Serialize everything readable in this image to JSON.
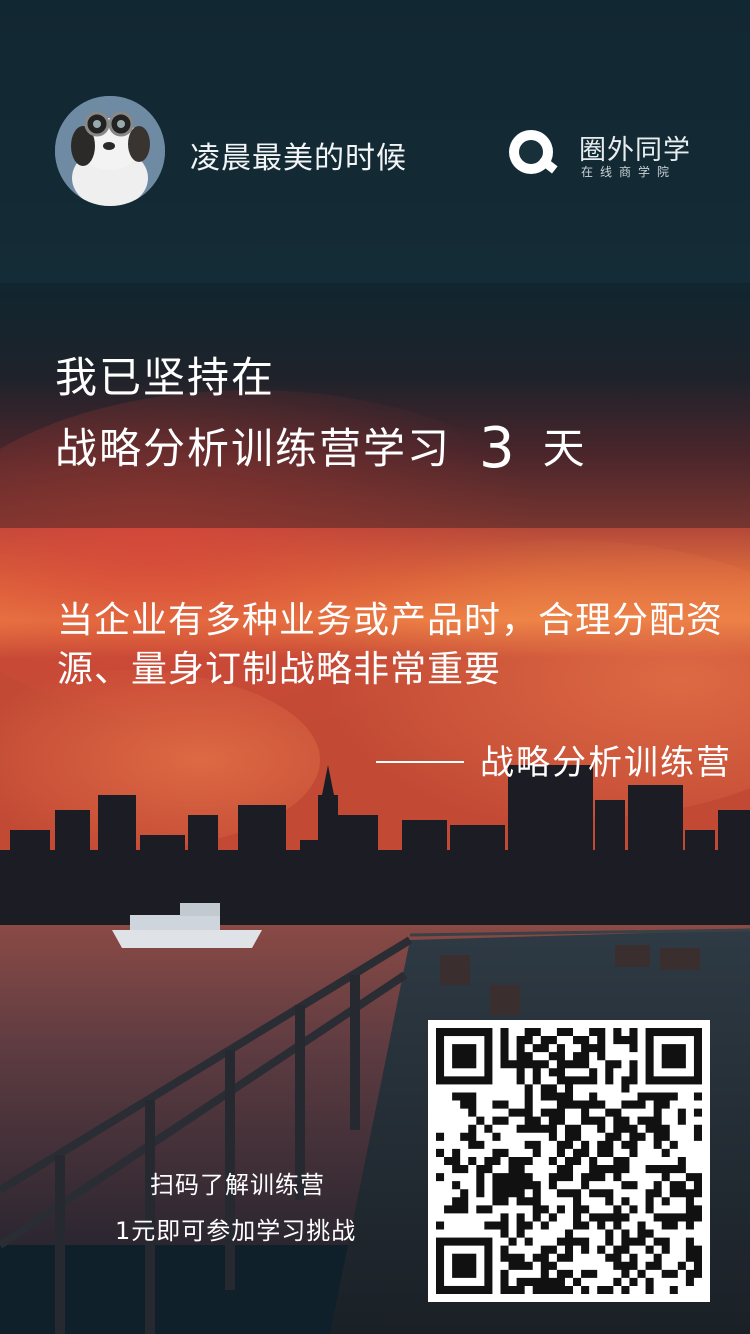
{
  "profile": {
    "username": "凌晨最美的时候",
    "avatar_icon": "dog-with-glasses-avatar"
  },
  "brand": {
    "name": "圈外同学",
    "subtitle": "在线商学院",
    "logo_icon": "q-logo-icon",
    "color": "#ffffff"
  },
  "headline": {
    "line1": "我已坚持在",
    "line2_prefix": "战略分析训练营学习",
    "days": "3",
    "day_unit": "天"
  },
  "quote": {
    "text": "当企业有多种业务或产品时，合理分配资源、量身订制战略非常重要",
    "attribution": "战略分析训练营"
  },
  "cta": {
    "line1": "扫码了解训练营",
    "line2": "1元即可参加学习挑战"
  },
  "qr": {
    "icon": "qr-code"
  },
  "colors": {
    "sky_top": "#10232d",
    "sunset_red": "#c8432f",
    "sunset_orange": "#e07a3a",
    "water": "#5a3a3e"
  }
}
